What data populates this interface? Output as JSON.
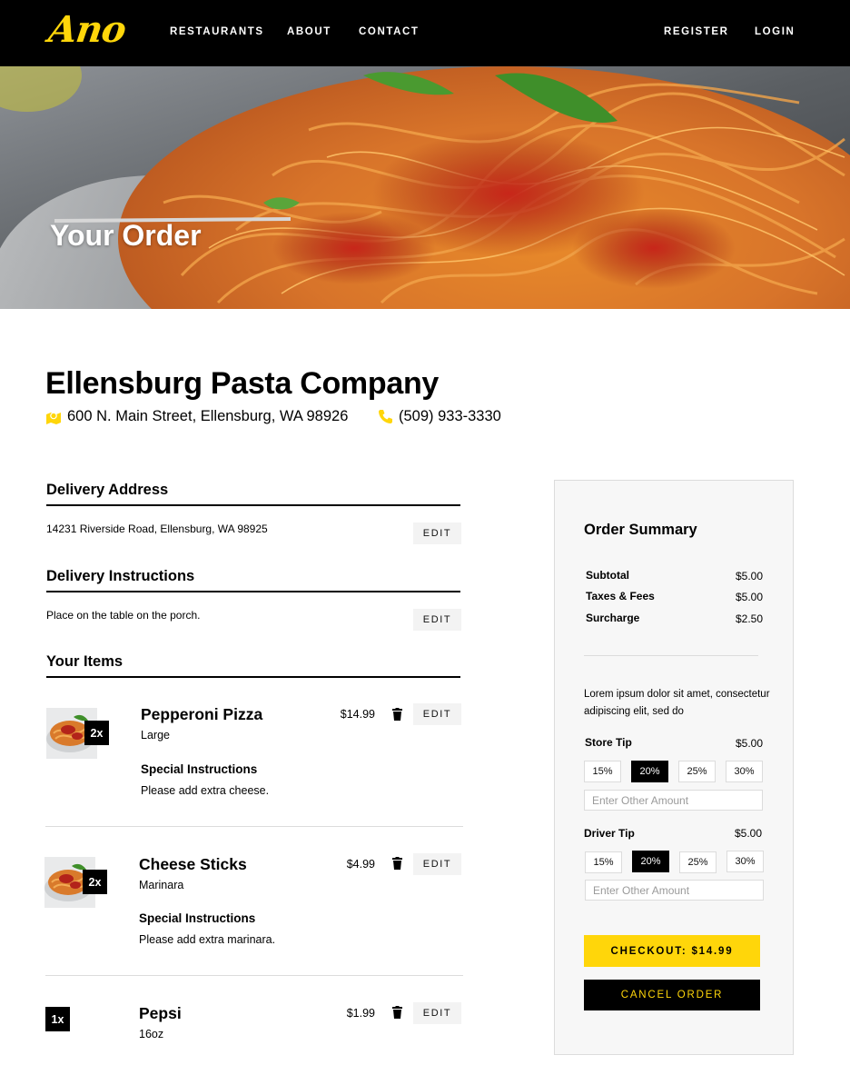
{
  "nav": {
    "logo": "Ano",
    "links": [
      "RESTAURANTS",
      "ABOUT",
      "CONTACT"
    ],
    "auth": [
      "REGISTER",
      "LOGIN"
    ]
  },
  "hero": {
    "title": "Your Order"
  },
  "restaurant": {
    "name": "Ellensburg Pasta Company",
    "address": "600 N. Main Street, Ellensburg, WA 98926",
    "phone": "(509) 933-3330"
  },
  "delivery_address": {
    "heading": "Delivery Address",
    "text": "14231 Riverside Road, Ellensburg, WA 98925",
    "edit_label": "EDIT"
  },
  "delivery_instructions": {
    "heading": "Delivery Instructions",
    "text": "Place on the table on the porch.",
    "edit_label": "EDIT"
  },
  "items_section": {
    "heading": "Your Items"
  },
  "items": [
    {
      "qty": "2x",
      "name": "Pepperoni Pizza",
      "price": "$14.99",
      "variant": "Large",
      "si_label": "Special Instructions",
      "si_text": "Please add extra cheese.",
      "edit_label": "EDIT"
    },
    {
      "qty": "2x",
      "name": "Cheese Sticks",
      "price": "$4.99",
      "variant": "Marinara",
      "si_label": "Special Instructions",
      "si_text": "Please add extra marinara.",
      "edit_label": "EDIT"
    },
    {
      "qty": "1x",
      "name": "Pepsi",
      "price": "$1.99",
      "variant": "16oz",
      "edit_label": "EDIT"
    }
  ],
  "summary": {
    "title": "Order Summary",
    "lines": [
      {
        "label": "Subtotal",
        "value": "$5.00"
      },
      {
        "label": "Taxes & Fees",
        "value": "$5.00"
      },
      {
        "label": "Surcharge",
        "value": "$2.50"
      }
    ],
    "description": "Lorem ipsum dolor sit amet, consectetur adipiscing elit, sed do",
    "store_tip": {
      "label": "Store Tip",
      "value": "$5.00",
      "options": [
        "15%",
        "20%",
        "25%",
        "30%"
      ],
      "selected": "20%",
      "placeholder": "Enter Other Amount"
    },
    "driver_tip": {
      "label": "Driver Tip",
      "value": "$5.00",
      "options": [
        "15%",
        "20%",
        "25%",
        "30%"
      ],
      "selected": "20%",
      "placeholder": "Enter Other Amount"
    },
    "checkout_label": "CHECKOUT: $14.99",
    "cancel_label": "CANCEL ORDER"
  },
  "colors": {
    "accent": "#ffd60a",
    "nav_bg": "#000000",
    "panel_bg": "#f7f7f7"
  }
}
